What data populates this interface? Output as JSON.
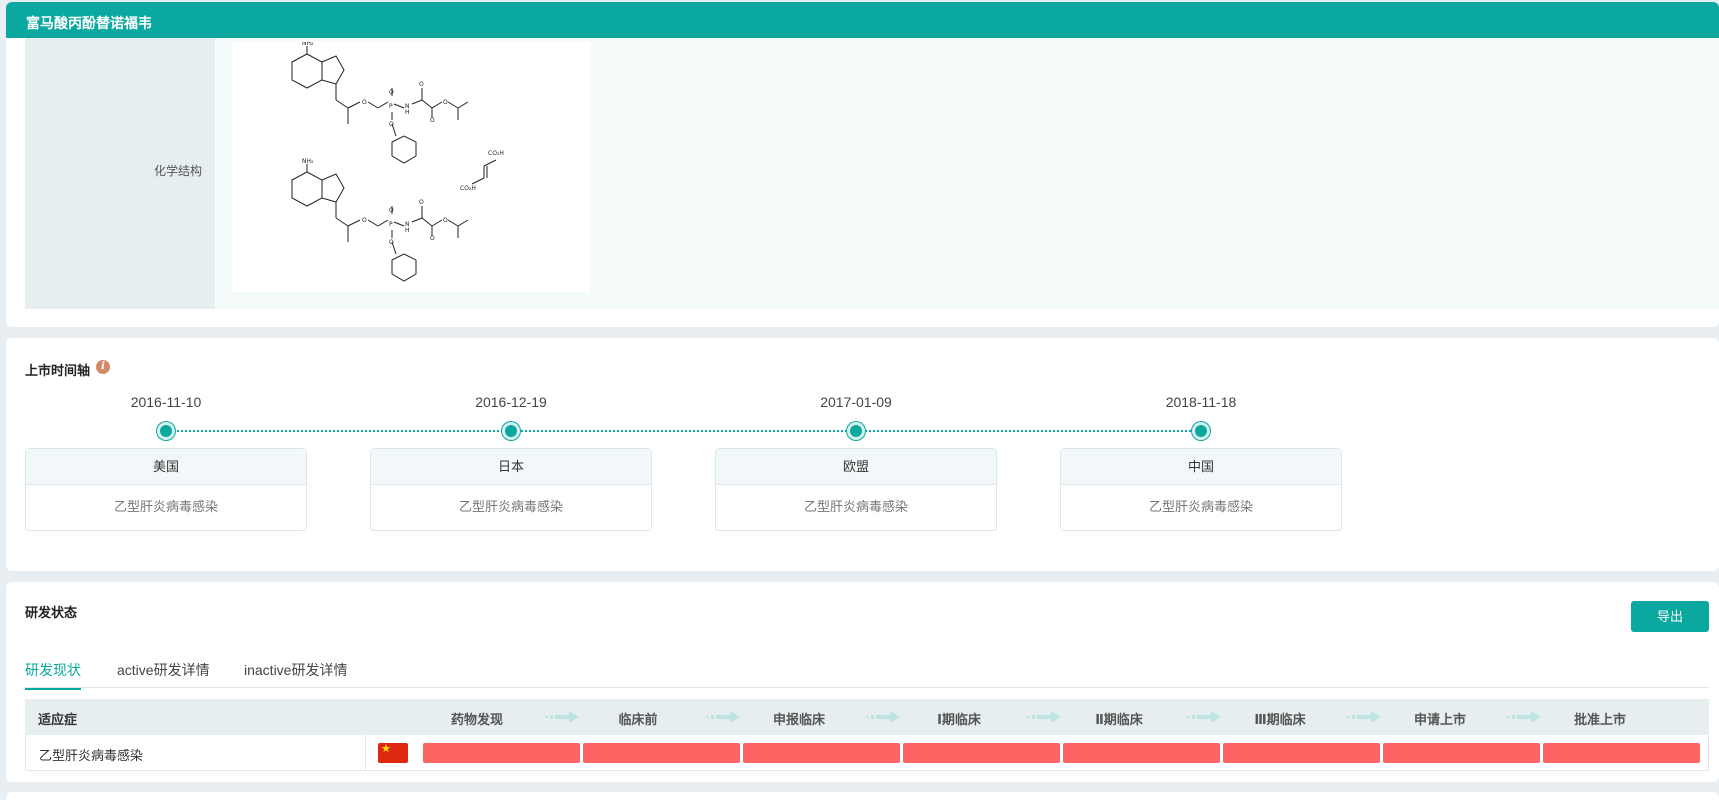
{
  "header": {
    "title": "富马酸丙酚替诺福韦"
  },
  "structure": {
    "label": "化学结构",
    "atoms": {
      "nh2": "NH₂",
      "o": "O",
      "n": "N",
      "p": "P",
      "h": "H",
      "co2h": "CO₂H"
    }
  },
  "timeline": {
    "title": "上市时间轴",
    "info_icon": "info-icon",
    "events": [
      {
        "date": "2016-11-10",
        "region": "美国",
        "indication": "乙型肝炎病毒感染"
      },
      {
        "date": "2016-12-19",
        "region": "日本",
        "indication": "乙型肝炎病毒感染"
      },
      {
        "date": "2017-01-09",
        "region": "欧盟",
        "indication": "乙型肝炎病毒感染"
      },
      {
        "date": "2018-11-18",
        "region": "中国",
        "indication": "乙型肝炎病毒感染"
      }
    ]
  },
  "rd_status": {
    "title": "研发状态",
    "export_label": "导出",
    "tabs": [
      {
        "label": "研发现状",
        "active": true
      },
      {
        "label": "active研发详情",
        "active": false
      },
      {
        "label": "inactive研发详情",
        "active": false
      }
    ],
    "indication_header": "适应症",
    "stages": [
      "药物发现",
      "临床前",
      "申报临床",
      "Ⅰ期临床",
      "Ⅱ期临床",
      "Ⅲ期临床",
      "申请上市",
      "批准上市"
    ],
    "rows": [
      {
        "indication": "乙型肝炎病毒感染",
        "country_flag": "china-flag-icon",
        "progress_stages_filled": 8
      }
    ]
  },
  "colors": {
    "primary": "#0aa89e",
    "bar": "#ff6464",
    "background": "#e9eef3"
  }
}
